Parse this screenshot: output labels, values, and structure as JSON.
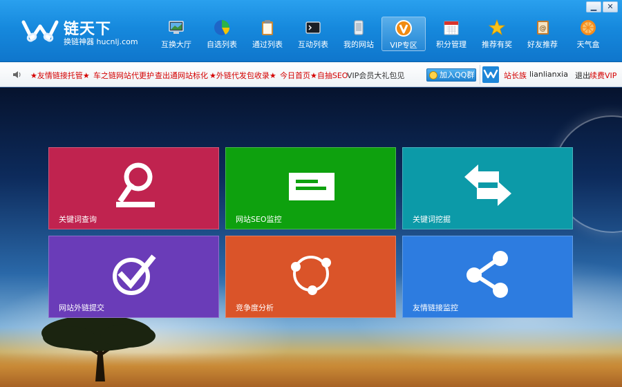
{
  "app": {
    "name": "链天下",
    "subtitle": "换链神器 hucnlj.com"
  },
  "window_controls": {
    "minimize": "▁",
    "close": "✕"
  },
  "nav": {
    "items": [
      {
        "label": "互换大厅",
        "icon": "monitor-icon"
      },
      {
        "label": "自选列表",
        "icon": "pie-chart-icon"
      },
      {
        "label": "通过列表",
        "icon": "clipboard-icon"
      },
      {
        "label": "互动列表",
        "icon": "terminal-icon"
      },
      {
        "label": "我的网站",
        "icon": "phone-icon"
      },
      {
        "label": "VIP专区",
        "icon": "vip-icon",
        "active": true
      },
      {
        "label": "积分管理",
        "icon": "calendar-icon"
      },
      {
        "label": "推荐有奖",
        "icon": "star-icon"
      },
      {
        "label": "好友推荐",
        "icon": "address-book-icon"
      },
      {
        "label": "天气盒",
        "icon": "orange-icon"
      }
    ]
  },
  "ticker": {
    "items": [
      {
        "text": "★友情链接托管★",
        "color": "red"
      },
      {
        "text": "车之链网站代更护",
        "color": "red"
      },
      {
        "text": "查出通网站标化",
        "color": "red"
      },
      {
        "text": "★外链代发包收录★",
        "color": "red"
      },
      {
        "text": "今日首页★自抽SEO",
        "color": "red"
      },
      {
        "text": "VIP会员大礼包见",
        "color": "dark"
      }
    ],
    "qq_button": "加入QQ群",
    "user": {
      "group": "站长族",
      "username": "lianlianxia",
      "logout": "退出",
      "vip_link": "续费VIP"
    }
  },
  "tiles": [
    {
      "label": "关键词查询",
      "color": "#c0234f",
      "icon": "search-icon"
    },
    {
      "label": "网站SEO监控",
      "color": "#0ea10e",
      "icon": "message-icon"
    },
    {
      "label": "关键词挖掘",
      "color": "#0c9aa8",
      "icon": "swap-arrows-icon"
    },
    {
      "label": "网站外链提交",
      "color": "#6a3cb8",
      "icon": "checkmark-icon"
    },
    {
      "label": "竞争度分析",
      "color": "#da5429",
      "icon": "sync-icon"
    },
    {
      "label": "友情链接监控",
      "color": "#2d7ce0",
      "icon": "share-icon"
    }
  ]
}
